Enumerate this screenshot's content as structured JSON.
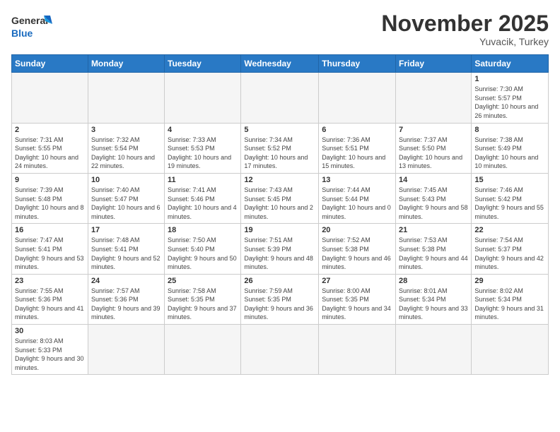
{
  "header": {
    "logo_general": "General",
    "logo_blue": "Blue",
    "month_title": "November 2025",
    "location": "Yuvacik, Turkey"
  },
  "days_of_week": [
    "Sunday",
    "Monday",
    "Tuesday",
    "Wednesday",
    "Thursday",
    "Friday",
    "Saturday"
  ],
  "weeks": [
    [
      {
        "day": "",
        "info": ""
      },
      {
        "day": "",
        "info": ""
      },
      {
        "day": "",
        "info": ""
      },
      {
        "day": "",
        "info": ""
      },
      {
        "day": "",
        "info": ""
      },
      {
        "day": "",
        "info": ""
      },
      {
        "day": "1",
        "info": "Sunrise: 7:30 AM\nSunset: 5:57 PM\nDaylight: 10 hours and 26 minutes."
      }
    ],
    [
      {
        "day": "2",
        "info": "Sunrise: 7:31 AM\nSunset: 5:55 PM\nDaylight: 10 hours and 24 minutes."
      },
      {
        "day": "3",
        "info": "Sunrise: 7:32 AM\nSunset: 5:54 PM\nDaylight: 10 hours and 22 minutes."
      },
      {
        "day": "4",
        "info": "Sunrise: 7:33 AM\nSunset: 5:53 PM\nDaylight: 10 hours and 19 minutes."
      },
      {
        "day": "5",
        "info": "Sunrise: 7:34 AM\nSunset: 5:52 PM\nDaylight: 10 hours and 17 minutes."
      },
      {
        "day": "6",
        "info": "Sunrise: 7:36 AM\nSunset: 5:51 PM\nDaylight: 10 hours and 15 minutes."
      },
      {
        "day": "7",
        "info": "Sunrise: 7:37 AM\nSunset: 5:50 PM\nDaylight: 10 hours and 13 minutes."
      },
      {
        "day": "8",
        "info": "Sunrise: 7:38 AM\nSunset: 5:49 PM\nDaylight: 10 hours and 10 minutes."
      }
    ],
    [
      {
        "day": "9",
        "info": "Sunrise: 7:39 AM\nSunset: 5:48 PM\nDaylight: 10 hours and 8 minutes."
      },
      {
        "day": "10",
        "info": "Sunrise: 7:40 AM\nSunset: 5:47 PM\nDaylight: 10 hours and 6 minutes."
      },
      {
        "day": "11",
        "info": "Sunrise: 7:41 AM\nSunset: 5:46 PM\nDaylight: 10 hours and 4 minutes."
      },
      {
        "day": "12",
        "info": "Sunrise: 7:43 AM\nSunset: 5:45 PM\nDaylight: 10 hours and 2 minutes."
      },
      {
        "day": "13",
        "info": "Sunrise: 7:44 AM\nSunset: 5:44 PM\nDaylight: 10 hours and 0 minutes."
      },
      {
        "day": "14",
        "info": "Sunrise: 7:45 AM\nSunset: 5:43 PM\nDaylight: 9 hours and 58 minutes."
      },
      {
        "day": "15",
        "info": "Sunrise: 7:46 AM\nSunset: 5:42 PM\nDaylight: 9 hours and 55 minutes."
      }
    ],
    [
      {
        "day": "16",
        "info": "Sunrise: 7:47 AM\nSunset: 5:41 PM\nDaylight: 9 hours and 53 minutes."
      },
      {
        "day": "17",
        "info": "Sunrise: 7:48 AM\nSunset: 5:41 PM\nDaylight: 9 hours and 52 minutes."
      },
      {
        "day": "18",
        "info": "Sunrise: 7:50 AM\nSunset: 5:40 PM\nDaylight: 9 hours and 50 minutes."
      },
      {
        "day": "19",
        "info": "Sunrise: 7:51 AM\nSunset: 5:39 PM\nDaylight: 9 hours and 48 minutes."
      },
      {
        "day": "20",
        "info": "Sunrise: 7:52 AM\nSunset: 5:38 PM\nDaylight: 9 hours and 46 minutes."
      },
      {
        "day": "21",
        "info": "Sunrise: 7:53 AM\nSunset: 5:38 PM\nDaylight: 9 hours and 44 minutes."
      },
      {
        "day": "22",
        "info": "Sunrise: 7:54 AM\nSunset: 5:37 PM\nDaylight: 9 hours and 42 minutes."
      }
    ],
    [
      {
        "day": "23",
        "info": "Sunrise: 7:55 AM\nSunset: 5:36 PM\nDaylight: 9 hours and 41 minutes."
      },
      {
        "day": "24",
        "info": "Sunrise: 7:57 AM\nSunset: 5:36 PM\nDaylight: 9 hours and 39 minutes."
      },
      {
        "day": "25",
        "info": "Sunrise: 7:58 AM\nSunset: 5:35 PM\nDaylight: 9 hours and 37 minutes."
      },
      {
        "day": "26",
        "info": "Sunrise: 7:59 AM\nSunset: 5:35 PM\nDaylight: 9 hours and 36 minutes."
      },
      {
        "day": "27",
        "info": "Sunrise: 8:00 AM\nSunset: 5:35 PM\nDaylight: 9 hours and 34 minutes."
      },
      {
        "day": "28",
        "info": "Sunrise: 8:01 AM\nSunset: 5:34 PM\nDaylight: 9 hours and 33 minutes."
      },
      {
        "day": "29",
        "info": "Sunrise: 8:02 AM\nSunset: 5:34 PM\nDaylight: 9 hours and 31 minutes."
      }
    ],
    [
      {
        "day": "30",
        "info": "Sunrise: 8:03 AM\nSunset: 5:33 PM\nDaylight: 9 hours and 30 minutes."
      },
      {
        "day": "",
        "info": ""
      },
      {
        "day": "",
        "info": ""
      },
      {
        "day": "",
        "info": ""
      },
      {
        "day": "",
        "info": ""
      },
      {
        "day": "",
        "info": ""
      },
      {
        "day": "",
        "info": ""
      }
    ]
  ]
}
